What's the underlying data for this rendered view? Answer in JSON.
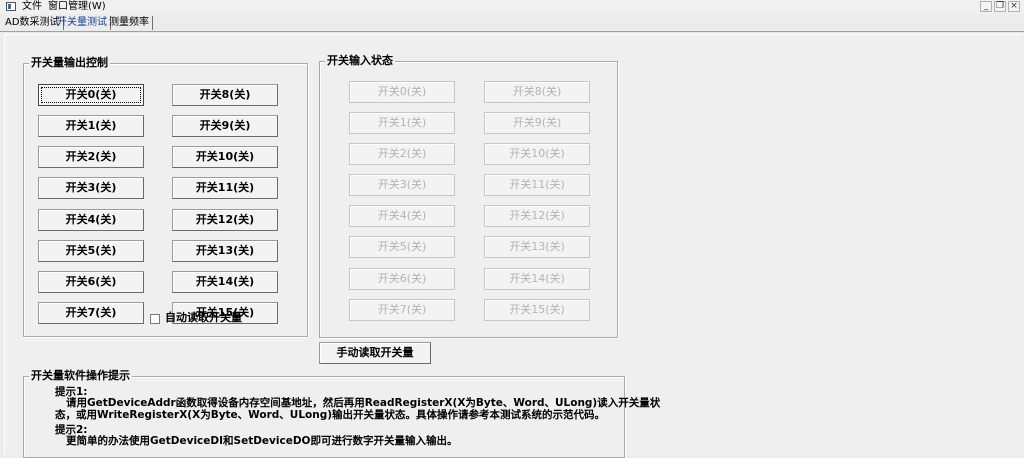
{
  "menubar": {
    "items": [
      "文件",
      "窗口管理(W)"
    ],
    "window_controls": [
      "minimize-icon",
      "restore-icon",
      "close-icon"
    ]
  },
  "tabs": [
    {
      "label": "AD数采测试",
      "active": false
    },
    {
      "label": "开关量测试",
      "active": true
    },
    {
      "label": "测量频率",
      "active": false
    }
  ],
  "output_group": {
    "title": "开关量输出控制",
    "buttons_left": [
      "开关0(关)",
      "开关1(关)",
      "开关2(关)",
      "开关3(关)",
      "开关4(关)",
      "开关5(关)",
      "开关6(关)",
      "开关7(关)"
    ],
    "buttons_right": [
      "开关8(关)",
      "开关9(关)",
      "开关10(关)",
      "开关11(关)",
      "开关12(关)",
      "开关13(关)",
      "开关14(关)",
      "开关15(关)"
    ]
  },
  "input_group": {
    "title": "开关输入状态",
    "buttons_left": [
      "开关0(关)",
      "开关1(关)",
      "开关2(关)",
      "开关3(关)",
      "开关4(关)",
      "开关5(关)",
      "开关6(关)",
      "开关7(关)"
    ],
    "buttons_right": [
      "开关8(关)",
      "开关9(关)",
      "开关10(关)",
      "开关11(关)",
      "开关12(关)",
      "开关13(关)",
      "开关14(关)",
      "开关15(关)"
    ]
  },
  "auto_read": {
    "label": "自动读取开关量",
    "checked": false
  },
  "manual_read_button": "手动读取开关量",
  "tips_group": {
    "title": "开关量软件操作提示",
    "tip1_title": "提示1:",
    "tip1_line1": "请用GetDeviceAddr函数取得设备内存空间基地址，然后再用ReadRegisterX(X为Byte、Word、ULong)读入开关量状",
    "tip1_line2": "态，或用WriteRegisterX(X为Byte、Word、ULong)输出开关量状态。具体操作请参考本测试系统的示范代码。",
    "tip2_title": "提示2:",
    "tip2_line1": "更简单的办法使用GetDeviceDI和SetDeviceDO即可进行数字开关量输入输出。"
  }
}
